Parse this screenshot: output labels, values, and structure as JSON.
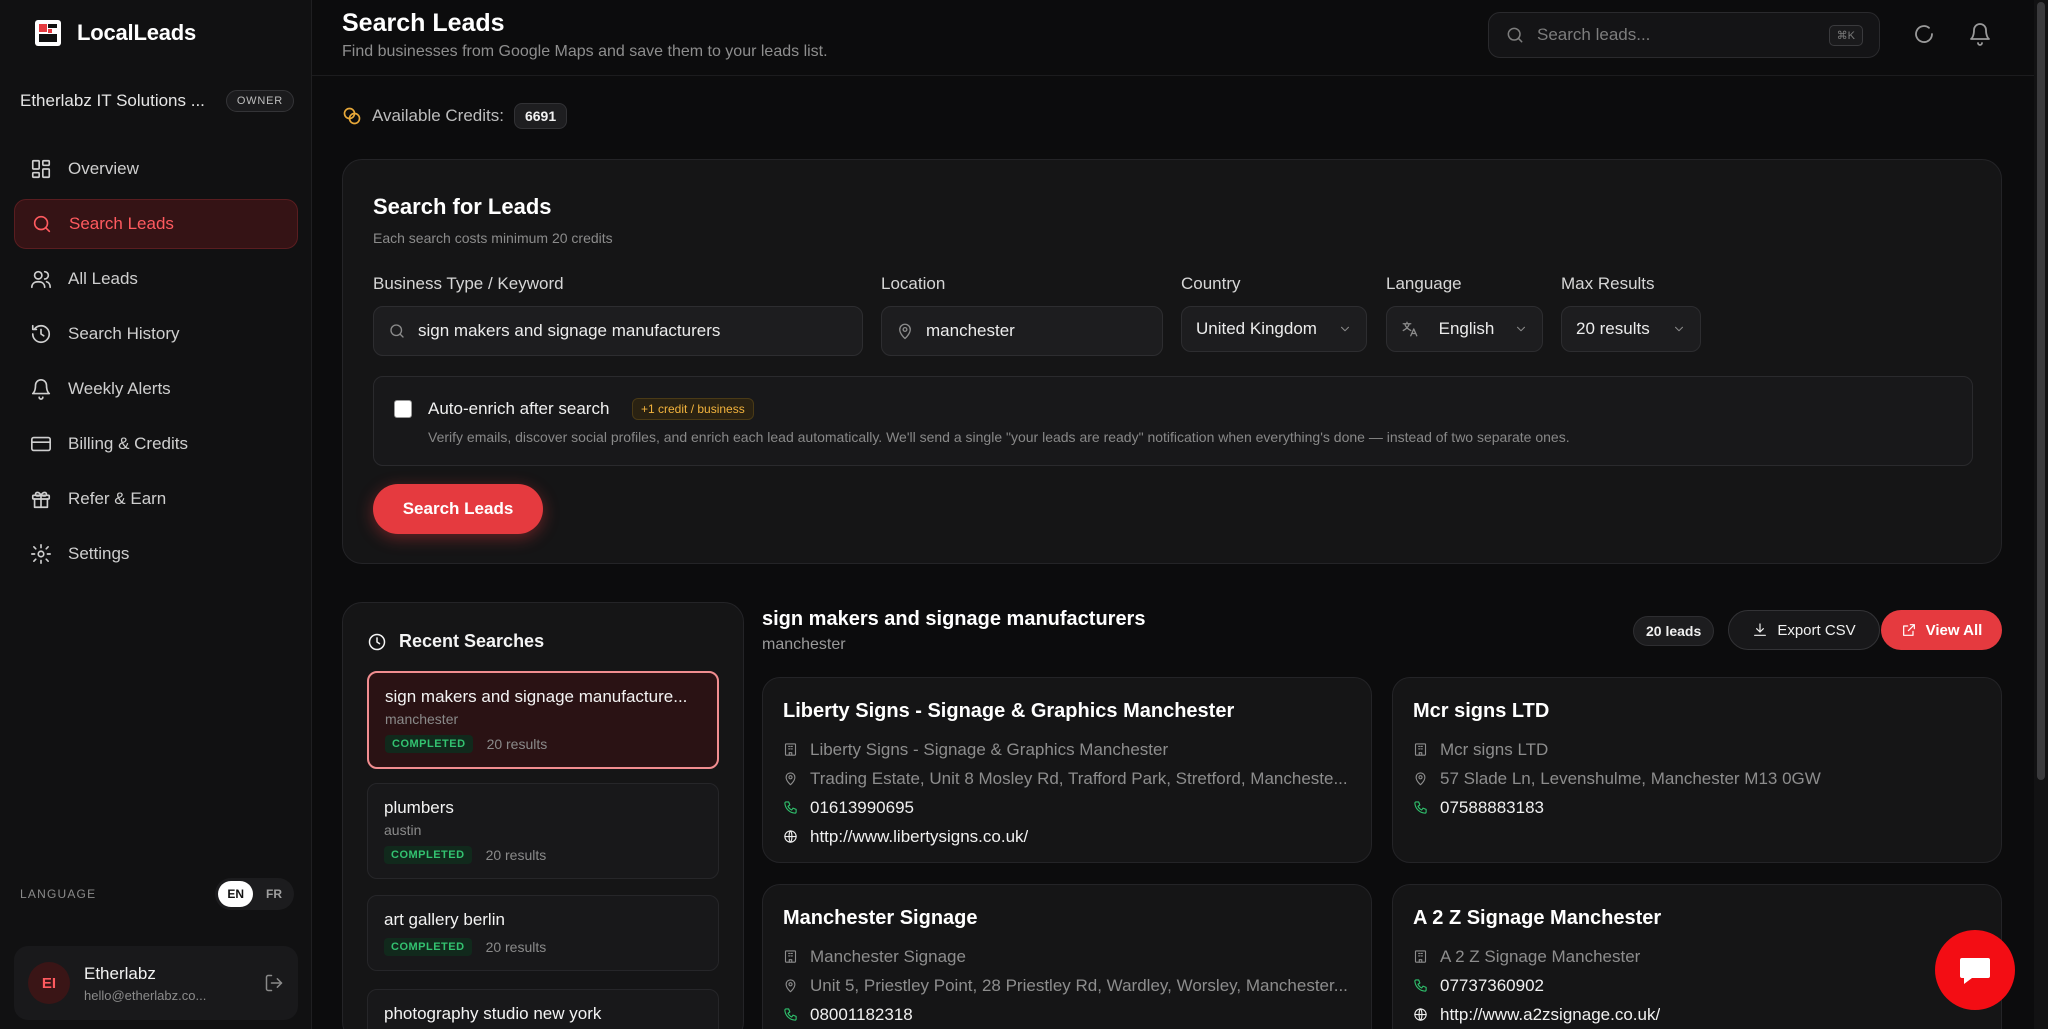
{
  "brand": {
    "name": "LocalLeads"
  },
  "org": {
    "name": "Etherlabz IT Solutions ...",
    "role": "OWNER"
  },
  "nav": [
    {
      "label": "Overview",
      "icon": "grid-icon",
      "active": false
    },
    {
      "label": "Search Leads",
      "icon": "search-icon",
      "active": true
    },
    {
      "label": "All Leads",
      "icon": "users-icon",
      "active": false
    },
    {
      "label": "Search History",
      "icon": "history-icon",
      "active": false
    },
    {
      "label": "Weekly Alerts",
      "icon": "bell-icon",
      "active": false
    },
    {
      "label": "Billing & Credits",
      "icon": "credit-card-icon",
      "active": false
    },
    {
      "label": "Refer & Earn",
      "icon": "gift-icon",
      "active": false
    },
    {
      "label": "Settings",
      "icon": "gear-icon",
      "active": false
    }
  ],
  "language": {
    "label": "LANGUAGE",
    "options": [
      "EN",
      "FR"
    ],
    "selected": "EN"
  },
  "user": {
    "initials": "EI",
    "name": "Etherlabz",
    "email": "hello@etherlabz.co..."
  },
  "header": {
    "title": "Search Leads",
    "subtitle": "Find businesses from Google Maps and save them to your leads list.",
    "search_placeholder": "Search leads...",
    "shortcut": "⌘K"
  },
  "credits": {
    "label": "Available Credits:",
    "value": "6691"
  },
  "search_form": {
    "title": "Search for Leads",
    "subtitle": "Each search costs minimum 20 credits",
    "keyword_label": "Business Type / Keyword",
    "keyword_value": "sign makers and signage manufacturers",
    "location_label": "Location",
    "location_value": "manchester",
    "country_label": "Country",
    "country_value": "United Kingdom",
    "language_label": "Language",
    "language_value": "English",
    "max_label": "Max Results",
    "max_value": "20 results",
    "enrich_title": "Auto-enrich after search",
    "enrich_tag": "+1 credit / business",
    "enrich_desc": "Verify emails, discover social profiles, and enrich each lead automatically. We'll send a single \"your leads are ready\" notification when everything's done — instead of two separate ones.",
    "enrich_checked": false,
    "submit_label": "Search Leads"
  },
  "recent": {
    "title": "Recent Searches",
    "items": [
      {
        "title": "sign makers and signage manufacture...",
        "location": "manchester",
        "status": "COMPLETED",
        "results": "20 results"
      },
      {
        "title": "plumbers",
        "location": "austin",
        "status": "COMPLETED",
        "results": "20 results"
      },
      {
        "title": "art gallery berlin",
        "location": "",
        "status": "COMPLETED",
        "results": "20 results"
      },
      {
        "title": "photography studio new york",
        "location": "",
        "status": "",
        "results": ""
      }
    ]
  },
  "results": {
    "title": "sign makers and signage manufacturers",
    "location": "manchester",
    "count": "20 leads",
    "export_label": "Export CSV",
    "view_label": "View All",
    "cards": [
      {
        "name": "Liberty Signs - Signage & Graphics Manchester",
        "business": "Liberty Signs - Signage & Graphics Manchester",
        "address": "Trading Estate, Unit 8 Mosley Rd, Trafford Park, Stretford, Mancheste...",
        "phone": "01613990695",
        "website": "http://www.libertysigns.co.uk/"
      },
      {
        "name": "Mcr signs LTD",
        "business": "Mcr signs LTD",
        "address": "57 Slade Ln, Levenshulme, Manchester M13 0GW",
        "phone": "07588883183",
        "website": ""
      },
      {
        "name": "Manchester Signage",
        "business": "Manchester Signage",
        "address": "Unit 5, Priestley Point, 28 Priestley Rd, Wardley, Worsley, Manchester...",
        "phone": "08001182318",
        "website": ""
      },
      {
        "name": "A 2 Z Signage Manchester",
        "business": "A 2 Z Signage Manchester",
        "address": "",
        "phone": "07737360902",
        "website": "http://www.a2zsignage.co.uk/"
      }
    ]
  },
  "colors": {
    "accent": "#e53a3f",
    "success": "#33c270",
    "background": "#0c0c0d"
  }
}
